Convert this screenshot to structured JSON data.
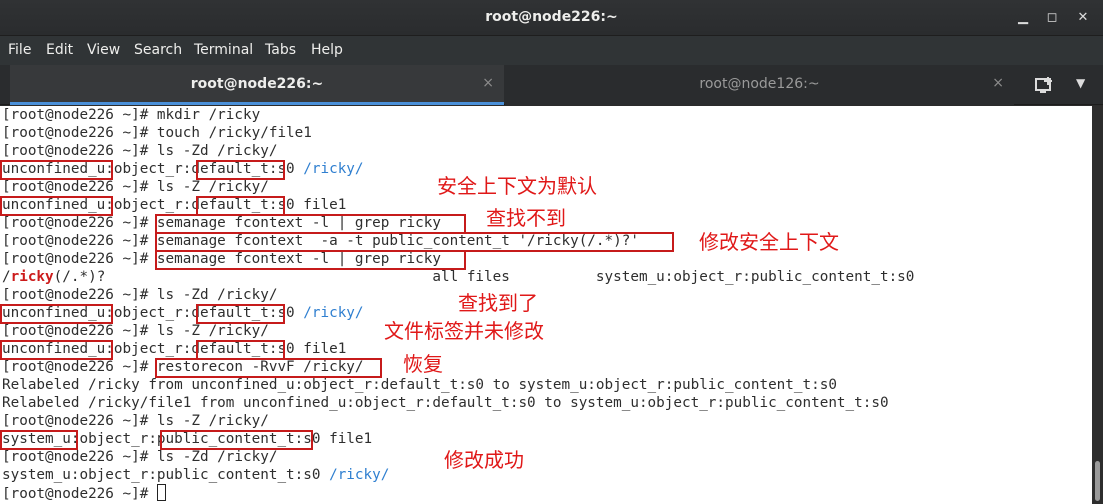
{
  "window": {
    "title": "root@node226:~"
  },
  "menu": [
    "File",
    "Edit",
    "View",
    "Search",
    "Terminal",
    "Tabs",
    "Help"
  ],
  "tabs": [
    {
      "label": "root@node226:~",
      "close": "×"
    },
    {
      "label": "root@node126:~",
      "close": "×"
    }
  ],
  "terminal": {
    "prompt": "[root@node226 ~]# ",
    "lines": {
      "l1": "[root@node226 ~]# mkdir /ricky",
      "l2": "[root@node226 ~]# touch /ricky/file1",
      "l3": "[root@node226 ~]# ls -Zd /ricky/",
      "l4_a": "unconfined_u:object_r:default_t:s0 ",
      "l4_b": "/ricky/",
      "l5": "[root@node226 ~]# ls -Z /ricky/",
      "l6": "unconfined_u:object_r:default_t:s0 file1",
      "l7": "[root@node226 ~]# semanage fcontext -l | grep ricky",
      "l8": "[root@node226 ~]# semanage fcontext  -a -t public_content_t '/ricky(/.*)?'",
      "l9": "[root@node226 ~]# semanage fcontext -l | grep ricky",
      "l10_a": "/",
      "l10_b": "ricky",
      "l10_c": "(/.*)?                                      all files          system_u:object_r:public_content_t:s0",
      "l11": "[root@node226 ~]# ls -Zd /ricky/",
      "l12_a": "unconfined_u:object_r:default_t:s0 ",
      "l12_b": "/ricky/",
      "l13": "[root@node226 ~]# ls -Z /ricky/",
      "l14": "unconfined_u:object_r:default_t:s0 file1",
      "l15": "[root@node226 ~]# restorecon -RvvF /ricky/",
      "l16": "Relabeled /ricky from unconfined_u:object_r:default_t:s0 to system_u:object_r:public_content_t:s0",
      "l17": "Relabeled /ricky/file1 from unconfined_u:object_r:default_t:s0 to system_u:object_r:public_content_t:s0",
      "l18": "[root@node226 ~]# ls -Z /ricky/",
      "l19": "system_u:object_r:public_content_t:s0 file1",
      "l20": "[root@node226 ~]# ls -Zd /ricky/",
      "l21_a": "system_u:object_r:public_content_t:s0 ",
      "l21_b": "/ricky/",
      "l22": "[root@node226 ~]# "
    }
  },
  "annotations": {
    "default_context": "安全上下文为默认",
    "not_found": "查找不到",
    "modify_context": "修改安全上下文",
    "found": "查找到了",
    "label_unchanged": "文件标签并未修改",
    "restore": "恢复",
    "success": "修改成功"
  },
  "colors": {
    "accent": "#4a90d9",
    "annotation": "#e01818",
    "dir_blue": "#2f7fd0"
  }
}
